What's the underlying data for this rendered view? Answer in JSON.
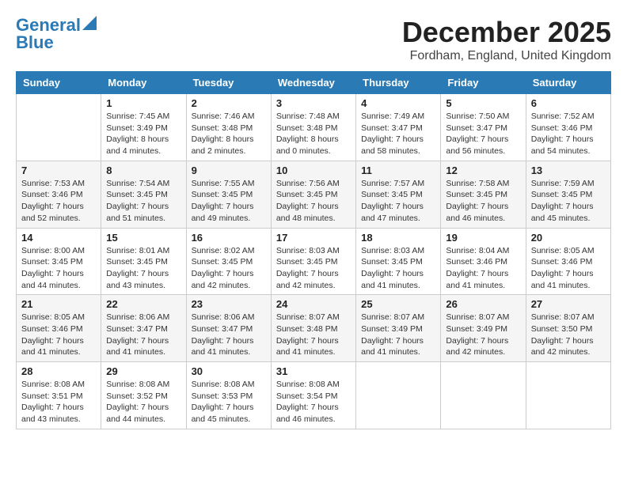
{
  "header": {
    "logo_line1": "General",
    "logo_line2": "Blue",
    "month": "December 2025",
    "location": "Fordham, England, United Kingdom"
  },
  "weekdays": [
    "Sunday",
    "Monday",
    "Tuesday",
    "Wednesday",
    "Thursday",
    "Friday",
    "Saturday"
  ],
  "weeks": [
    [
      {
        "day": "",
        "info": ""
      },
      {
        "day": "1",
        "info": "Sunrise: 7:45 AM\nSunset: 3:49 PM\nDaylight: 8 hours\nand 4 minutes."
      },
      {
        "day": "2",
        "info": "Sunrise: 7:46 AM\nSunset: 3:48 PM\nDaylight: 8 hours\nand 2 minutes."
      },
      {
        "day": "3",
        "info": "Sunrise: 7:48 AM\nSunset: 3:48 PM\nDaylight: 8 hours\nand 0 minutes."
      },
      {
        "day": "4",
        "info": "Sunrise: 7:49 AM\nSunset: 3:47 PM\nDaylight: 7 hours\nand 58 minutes."
      },
      {
        "day": "5",
        "info": "Sunrise: 7:50 AM\nSunset: 3:47 PM\nDaylight: 7 hours\nand 56 minutes."
      },
      {
        "day": "6",
        "info": "Sunrise: 7:52 AM\nSunset: 3:46 PM\nDaylight: 7 hours\nand 54 minutes."
      }
    ],
    [
      {
        "day": "7",
        "info": "Sunrise: 7:53 AM\nSunset: 3:46 PM\nDaylight: 7 hours\nand 52 minutes."
      },
      {
        "day": "8",
        "info": "Sunrise: 7:54 AM\nSunset: 3:45 PM\nDaylight: 7 hours\nand 51 minutes."
      },
      {
        "day": "9",
        "info": "Sunrise: 7:55 AM\nSunset: 3:45 PM\nDaylight: 7 hours\nand 49 minutes."
      },
      {
        "day": "10",
        "info": "Sunrise: 7:56 AM\nSunset: 3:45 PM\nDaylight: 7 hours\nand 48 minutes."
      },
      {
        "day": "11",
        "info": "Sunrise: 7:57 AM\nSunset: 3:45 PM\nDaylight: 7 hours\nand 47 minutes."
      },
      {
        "day": "12",
        "info": "Sunrise: 7:58 AM\nSunset: 3:45 PM\nDaylight: 7 hours\nand 46 minutes."
      },
      {
        "day": "13",
        "info": "Sunrise: 7:59 AM\nSunset: 3:45 PM\nDaylight: 7 hours\nand 45 minutes."
      }
    ],
    [
      {
        "day": "14",
        "info": "Sunrise: 8:00 AM\nSunset: 3:45 PM\nDaylight: 7 hours\nand 44 minutes."
      },
      {
        "day": "15",
        "info": "Sunrise: 8:01 AM\nSunset: 3:45 PM\nDaylight: 7 hours\nand 43 minutes."
      },
      {
        "day": "16",
        "info": "Sunrise: 8:02 AM\nSunset: 3:45 PM\nDaylight: 7 hours\nand 42 minutes."
      },
      {
        "day": "17",
        "info": "Sunrise: 8:03 AM\nSunset: 3:45 PM\nDaylight: 7 hours\nand 42 minutes."
      },
      {
        "day": "18",
        "info": "Sunrise: 8:03 AM\nSunset: 3:45 PM\nDaylight: 7 hours\nand 41 minutes."
      },
      {
        "day": "19",
        "info": "Sunrise: 8:04 AM\nSunset: 3:46 PM\nDaylight: 7 hours\nand 41 minutes."
      },
      {
        "day": "20",
        "info": "Sunrise: 8:05 AM\nSunset: 3:46 PM\nDaylight: 7 hours\nand 41 minutes."
      }
    ],
    [
      {
        "day": "21",
        "info": "Sunrise: 8:05 AM\nSunset: 3:46 PM\nDaylight: 7 hours\nand 41 minutes."
      },
      {
        "day": "22",
        "info": "Sunrise: 8:06 AM\nSunset: 3:47 PM\nDaylight: 7 hours\nand 41 minutes."
      },
      {
        "day": "23",
        "info": "Sunrise: 8:06 AM\nSunset: 3:47 PM\nDaylight: 7 hours\nand 41 minutes."
      },
      {
        "day": "24",
        "info": "Sunrise: 8:07 AM\nSunset: 3:48 PM\nDaylight: 7 hours\nand 41 minutes."
      },
      {
        "day": "25",
        "info": "Sunrise: 8:07 AM\nSunset: 3:49 PM\nDaylight: 7 hours\nand 41 minutes."
      },
      {
        "day": "26",
        "info": "Sunrise: 8:07 AM\nSunset: 3:49 PM\nDaylight: 7 hours\nand 42 minutes."
      },
      {
        "day": "27",
        "info": "Sunrise: 8:07 AM\nSunset: 3:50 PM\nDaylight: 7 hours\nand 42 minutes."
      }
    ],
    [
      {
        "day": "28",
        "info": "Sunrise: 8:08 AM\nSunset: 3:51 PM\nDaylight: 7 hours\nand 43 minutes."
      },
      {
        "day": "29",
        "info": "Sunrise: 8:08 AM\nSunset: 3:52 PM\nDaylight: 7 hours\nand 44 minutes."
      },
      {
        "day": "30",
        "info": "Sunrise: 8:08 AM\nSunset: 3:53 PM\nDaylight: 7 hours\nand 45 minutes."
      },
      {
        "day": "31",
        "info": "Sunrise: 8:08 AM\nSunset: 3:54 PM\nDaylight: 7 hours\nand 46 minutes."
      },
      {
        "day": "",
        "info": ""
      },
      {
        "day": "",
        "info": ""
      },
      {
        "day": "",
        "info": ""
      }
    ]
  ]
}
